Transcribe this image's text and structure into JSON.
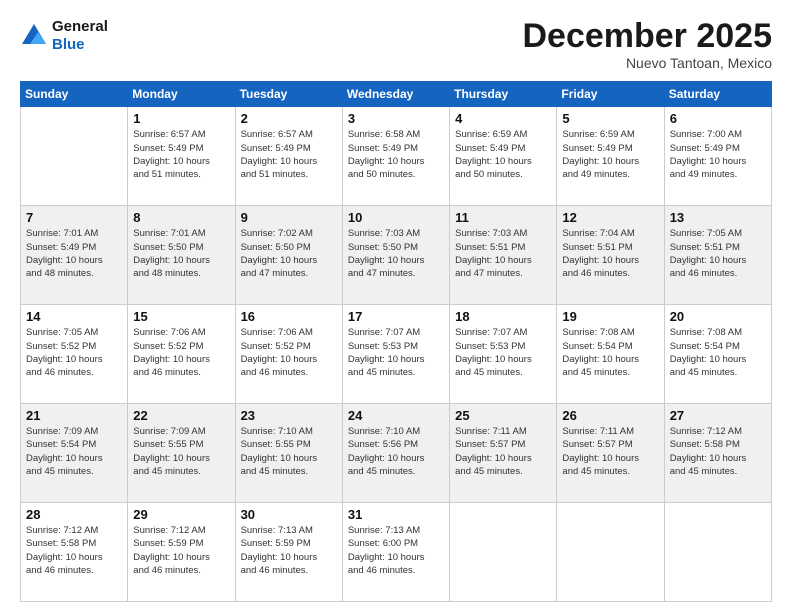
{
  "header": {
    "logo": {
      "line1": "General",
      "line2": "Blue"
    },
    "title": "December 2025",
    "subtitle": "Nuevo Tantoan, Mexico"
  },
  "weekdays": [
    "Sunday",
    "Monday",
    "Tuesday",
    "Wednesday",
    "Thursday",
    "Friday",
    "Saturday"
  ],
  "weeks": [
    [
      {
        "day": "",
        "info": ""
      },
      {
        "day": "1",
        "info": "Sunrise: 6:57 AM\nSunset: 5:49 PM\nDaylight: 10 hours\nand 51 minutes."
      },
      {
        "day": "2",
        "info": "Sunrise: 6:57 AM\nSunset: 5:49 PM\nDaylight: 10 hours\nand 51 minutes."
      },
      {
        "day": "3",
        "info": "Sunrise: 6:58 AM\nSunset: 5:49 PM\nDaylight: 10 hours\nand 50 minutes."
      },
      {
        "day": "4",
        "info": "Sunrise: 6:59 AM\nSunset: 5:49 PM\nDaylight: 10 hours\nand 50 minutes."
      },
      {
        "day": "5",
        "info": "Sunrise: 6:59 AM\nSunset: 5:49 PM\nDaylight: 10 hours\nand 49 minutes."
      },
      {
        "day": "6",
        "info": "Sunrise: 7:00 AM\nSunset: 5:49 PM\nDaylight: 10 hours\nand 49 minutes."
      }
    ],
    [
      {
        "day": "7",
        "info": "Sunrise: 7:01 AM\nSunset: 5:49 PM\nDaylight: 10 hours\nand 48 minutes."
      },
      {
        "day": "8",
        "info": "Sunrise: 7:01 AM\nSunset: 5:50 PM\nDaylight: 10 hours\nand 48 minutes."
      },
      {
        "day": "9",
        "info": "Sunrise: 7:02 AM\nSunset: 5:50 PM\nDaylight: 10 hours\nand 47 minutes."
      },
      {
        "day": "10",
        "info": "Sunrise: 7:03 AM\nSunset: 5:50 PM\nDaylight: 10 hours\nand 47 minutes."
      },
      {
        "day": "11",
        "info": "Sunrise: 7:03 AM\nSunset: 5:51 PM\nDaylight: 10 hours\nand 47 minutes."
      },
      {
        "day": "12",
        "info": "Sunrise: 7:04 AM\nSunset: 5:51 PM\nDaylight: 10 hours\nand 46 minutes."
      },
      {
        "day": "13",
        "info": "Sunrise: 7:05 AM\nSunset: 5:51 PM\nDaylight: 10 hours\nand 46 minutes."
      }
    ],
    [
      {
        "day": "14",
        "info": "Sunrise: 7:05 AM\nSunset: 5:52 PM\nDaylight: 10 hours\nand 46 minutes."
      },
      {
        "day": "15",
        "info": "Sunrise: 7:06 AM\nSunset: 5:52 PM\nDaylight: 10 hours\nand 46 minutes."
      },
      {
        "day": "16",
        "info": "Sunrise: 7:06 AM\nSunset: 5:52 PM\nDaylight: 10 hours\nand 46 minutes."
      },
      {
        "day": "17",
        "info": "Sunrise: 7:07 AM\nSunset: 5:53 PM\nDaylight: 10 hours\nand 45 minutes."
      },
      {
        "day": "18",
        "info": "Sunrise: 7:07 AM\nSunset: 5:53 PM\nDaylight: 10 hours\nand 45 minutes."
      },
      {
        "day": "19",
        "info": "Sunrise: 7:08 AM\nSunset: 5:54 PM\nDaylight: 10 hours\nand 45 minutes."
      },
      {
        "day": "20",
        "info": "Sunrise: 7:08 AM\nSunset: 5:54 PM\nDaylight: 10 hours\nand 45 minutes."
      }
    ],
    [
      {
        "day": "21",
        "info": "Sunrise: 7:09 AM\nSunset: 5:54 PM\nDaylight: 10 hours\nand 45 minutes."
      },
      {
        "day": "22",
        "info": "Sunrise: 7:09 AM\nSunset: 5:55 PM\nDaylight: 10 hours\nand 45 minutes."
      },
      {
        "day": "23",
        "info": "Sunrise: 7:10 AM\nSunset: 5:55 PM\nDaylight: 10 hours\nand 45 minutes."
      },
      {
        "day": "24",
        "info": "Sunrise: 7:10 AM\nSunset: 5:56 PM\nDaylight: 10 hours\nand 45 minutes."
      },
      {
        "day": "25",
        "info": "Sunrise: 7:11 AM\nSunset: 5:57 PM\nDaylight: 10 hours\nand 45 minutes."
      },
      {
        "day": "26",
        "info": "Sunrise: 7:11 AM\nSunset: 5:57 PM\nDaylight: 10 hours\nand 45 minutes."
      },
      {
        "day": "27",
        "info": "Sunrise: 7:12 AM\nSunset: 5:58 PM\nDaylight: 10 hours\nand 45 minutes."
      }
    ],
    [
      {
        "day": "28",
        "info": "Sunrise: 7:12 AM\nSunset: 5:58 PM\nDaylight: 10 hours\nand 46 minutes."
      },
      {
        "day": "29",
        "info": "Sunrise: 7:12 AM\nSunset: 5:59 PM\nDaylight: 10 hours\nand 46 minutes."
      },
      {
        "day": "30",
        "info": "Sunrise: 7:13 AM\nSunset: 5:59 PM\nDaylight: 10 hours\nand 46 minutes."
      },
      {
        "day": "31",
        "info": "Sunrise: 7:13 AM\nSunset: 6:00 PM\nDaylight: 10 hours\nand 46 minutes."
      },
      {
        "day": "",
        "info": ""
      },
      {
        "day": "",
        "info": ""
      },
      {
        "day": "",
        "info": ""
      }
    ]
  ]
}
